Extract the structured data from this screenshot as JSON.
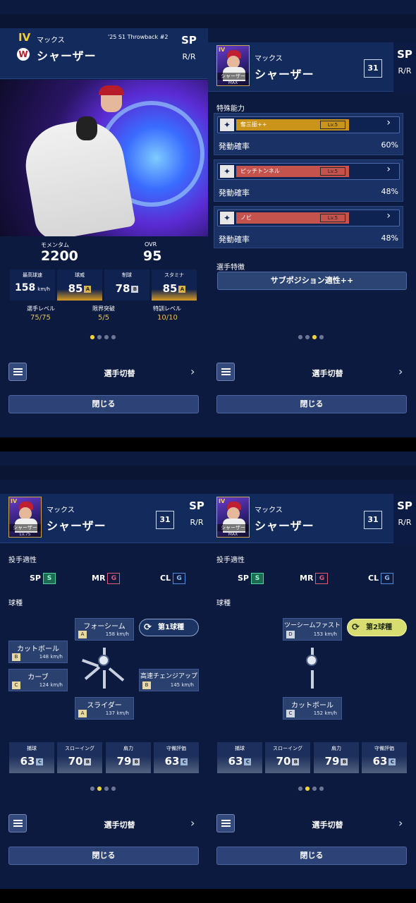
{
  "player": {
    "first": "マックス",
    "last": "シャーザー",
    "number": "31",
    "pos": "SP",
    "hand": "R/R",
    "series": "'25 S1 Throwback #2",
    "rank": "IV",
    "thumb_label": "シャーザー",
    "thumb_lv": "Lv.75",
    "thumb_max": "MAX"
  },
  "p1": {
    "momentum_label": "モメンタム",
    "momentum": "2200",
    "ovr_label": "OVR",
    "ovr": "95",
    "stats": [
      {
        "label": "最高球速",
        "value": "158",
        "unit": "km/h",
        "grade": ""
      },
      {
        "label": "球威",
        "value": "85",
        "grade": "A"
      },
      {
        "label": "制球",
        "value": "78",
        "grade": "B"
      },
      {
        "label": "スタミナ",
        "value": "85",
        "grade": "A"
      }
    ],
    "levels": [
      {
        "label": "選手レベル",
        "value": "75/75"
      },
      {
        "label": "限界突破",
        "value": "5/5"
      },
      {
        "label": "特訓レベル",
        "value": "10/10"
      }
    ]
  },
  "p2": {
    "special_title": "特殊能力",
    "skills": [
      {
        "name": "奪三振++",
        "lv": "Lv.5",
        "rate_label": "発動確率",
        "rate": "60%",
        "color": "#c99419"
      },
      {
        "name": "ピッチトンネル",
        "lv": "Lv.5",
        "rate_label": "発動確率",
        "rate": "48%",
        "color": "#c4524d"
      },
      {
        "name": "ノビ",
        "lv": "Lv.5",
        "rate_label": "発動確率",
        "rate": "48%",
        "color": "#c4524d"
      }
    ],
    "trait_title": "選手特徴",
    "trait_button": "サブポジション適性++"
  },
  "apt": {
    "title": "投手適性",
    "items": [
      {
        "pos": "SP",
        "grade": "S"
      },
      {
        "pos": "MR",
        "grade": "G"
      },
      {
        "pos": "CL",
        "grade": "G"
      }
    ],
    "pitch_title": "球種"
  },
  "p3": {
    "pitches": [
      {
        "name": "フォーシーム",
        "grade": "A",
        "speed": "158 km/h"
      },
      {
        "name": "カットボール",
        "grade": "B",
        "speed": "148 km/h"
      },
      {
        "name": "カーブ",
        "grade": "C",
        "speed": "124 km/h"
      },
      {
        "name": "高速チェンジアップ",
        "grade": "B",
        "speed": "145 km/h"
      },
      {
        "name": "スライダー",
        "grade": "A",
        "speed": "137 km/h"
      }
    ],
    "badge": "第1球種"
  },
  "p4": {
    "pitches": [
      {
        "name": "ツーシームファスト",
        "grade": "D",
        "speed": "153 km/h"
      },
      {
        "name": "カットボール",
        "grade": "C",
        "speed": "152 km/h"
      }
    ],
    "badge": "第2球種"
  },
  "fielding": [
    {
      "label": "捕球",
      "value": "63",
      "grade": "C"
    },
    {
      "label": "スローイング",
      "value": "70",
      "grade": "B"
    },
    {
      "label": "肩力",
      "value": "79",
      "grade": "B"
    },
    {
      "label": "守備評価",
      "value": "63",
      "grade": "C"
    }
  ],
  "nav": {
    "switch": "選手切替",
    "close": "閉じる"
  }
}
